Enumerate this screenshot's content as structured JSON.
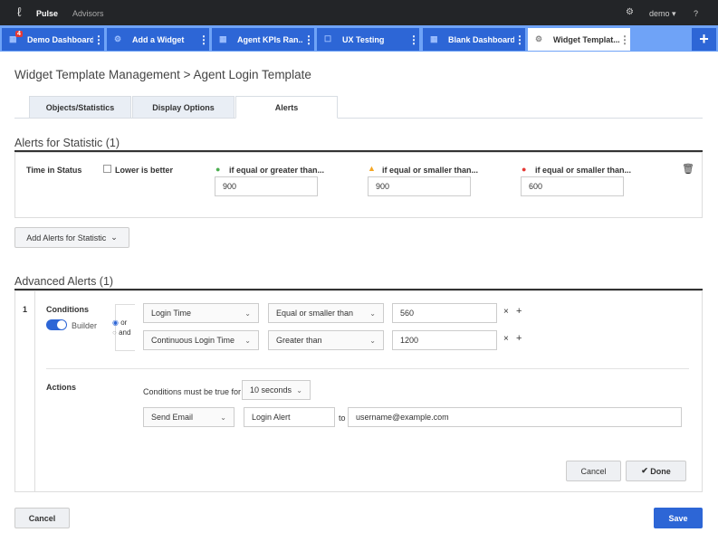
{
  "topbar": {
    "brand": "Pulse",
    "advisors": "Advisors",
    "user": "demo",
    "help": "?"
  },
  "tabs": [
    {
      "label": "Demo Dashboard",
      "icon": "grid-icon",
      "badge": "4"
    },
    {
      "label": "Add a Widget",
      "icon": "gear-icon"
    },
    {
      "label": "Agent KPIs Ran...",
      "icon": "grid-icon"
    },
    {
      "label": "UX Testing",
      "icon": "square-icon"
    },
    {
      "label": "Blank Dashboard",
      "icon": "grid-icon"
    },
    {
      "label": "Widget Templat...",
      "icon": "gear-icon",
      "active": true
    }
  ],
  "breadcrumb": "Widget Template Management > Agent Login Template",
  "subtabs": [
    "Objects/Statistics",
    "Display Options",
    "Alerts"
  ],
  "alerts": {
    "heading": "Alerts for Statistic (1)",
    "statistic": "Time in Status",
    "lower_is_better": "Lower is better",
    "thresholds": [
      {
        "label": "if equal or greater than...",
        "value": "900",
        "color": "#4caf50"
      },
      {
        "label": "if equal or smaller than...",
        "value": "900",
        "color": "#f5a623"
      },
      {
        "label": "if equal or smaller than...",
        "value": "600",
        "color": "#e53935"
      }
    ],
    "add_button": "Add Alerts for Statistic"
  },
  "advanced": {
    "heading": "Advanced Alerts (1)",
    "index": "1",
    "conditions_label": "Conditions",
    "builder": "Builder",
    "or": "or",
    "and": "and",
    "rows": [
      {
        "stat": "Login Time",
        "op": "Equal or smaller than",
        "value": "560"
      },
      {
        "stat": "Continuous Login Time",
        "op": "Greater than",
        "value": "1200"
      }
    ],
    "actions_label": "Actions",
    "must_be_true": "Conditions must be true for",
    "duration": "10 seconds",
    "action": "Send Email",
    "subject": "Login Alert",
    "to": "to",
    "email": "username@example.com",
    "cancel": "Cancel",
    "done": "Done"
  },
  "footer": {
    "cancel": "Cancel",
    "save": "Save"
  }
}
